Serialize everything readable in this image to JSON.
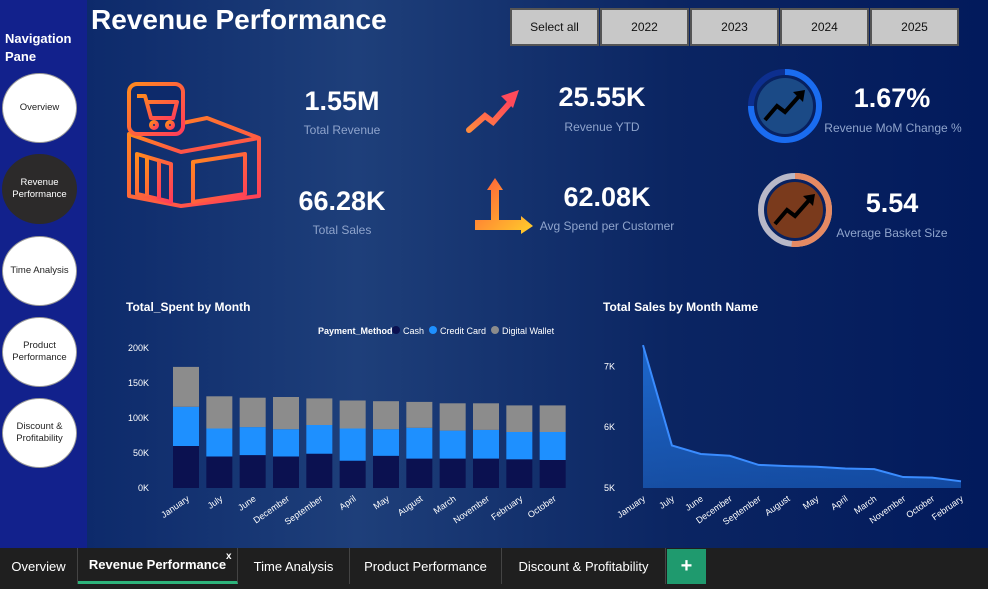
{
  "nav": {
    "title": "Navigation Pane",
    "buttons": [
      {
        "label": "Overview",
        "active": false
      },
      {
        "label": "Revenue Performance",
        "active": true
      },
      {
        "label": "Time Analysis",
        "active": false
      },
      {
        "label": "Product Performance",
        "active": false
      },
      {
        "label": "Discount & Profitability",
        "active": false
      }
    ]
  },
  "header": {
    "title": "Revenue Performance",
    "filters": [
      "Select all",
      "2022",
      "2023",
      "2024",
      "2025"
    ]
  },
  "kpis": {
    "total_revenue": {
      "value": "1.55M",
      "label": "Total Revenue"
    },
    "total_sales": {
      "value": "66.28K",
      "label": "Total Sales"
    },
    "revenue_ytd": {
      "value": "25.55K",
      "label": "Revenue YTD"
    },
    "avg_spend": {
      "value": "62.08K",
      "label": "Avg Spend per Customer"
    },
    "mom_change": {
      "value": "1.67%",
      "label": "Revenue MoM Change %"
    },
    "basket_size": {
      "value": "5.54",
      "label": "Average Basket Size"
    }
  },
  "colors": {
    "cash": "#0b1150",
    "credit_card": "#1e90ff",
    "digital_wallet": "#8c8c8c",
    "area": "#1f6fd8",
    "accent_tab": "#2db37b",
    "mom_ring": "#1a6cf0",
    "basket_ring": "#e58a63"
  },
  "chart_data": [
    {
      "type": "bar",
      "title": "Total_Spent by Month",
      "legend_title": "Payment_Method",
      "categories": [
        "January",
        "July",
        "June",
        "December",
        "September",
        "April",
        "May",
        "August",
        "March",
        "November",
        "February",
        "October"
      ],
      "y_ticks": [
        "0K",
        "50K",
        "100K",
        "150K",
        "200K"
      ],
      "ylim": [
        0,
        200000
      ],
      "series": [
        {
          "name": "Cash",
          "values": [
            60000,
            45000,
            47000,
            45000,
            49000,
            39000,
            46000,
            42000,
            42000,
            42000,
            41000,
            40000
          ]
        },
        {
          "name": "Credit Card",
          "values": [
            56000,
            40000,
            40000,
            39000,
            41000,
            46000,
            38000,
            44000,
            40000,
            41000,
            39000,
            40000
          ]
        },
        {
          "name": "Digital Wallet",
          "values": [
            57000,
            46000,
            42000,
            46000,
            38000,
            40000,
            40000,
            37000,
            39000,
            38000,
            38000,
            38000
          ]
        }
      ],
      "stacked": true,
      "legend": "top-right"
    },
    {
      "type": "area",
      "title": "Total Sales by Month Name",
      "categories": [
        "January",
        "July",
        "June",
        "December",
        "September",
        "August",
        "May",
        "April",
        "March",
        "November",
        "October",
        "February"
      ],
      "y_ticks": [
        "5K",
        "6K",
        "7K"
      ],
      "ylim": [
        5000,
        7500
      ],
      "values": [
        7350,
        5700,
        5560,
        5530,
        5380,
        5360,
        5350,
        5320,
        5310,
        5180,
        5170,
        5110
      ]
    }
  ],
  "tabs": [
    {
      "label": "Overview",
      "active": false
    },
    {
      "label": "Revenue Performance",
      "active": true
    },
    {
      "label": "Time Analysis",
      "active": false
    },
    {
      "label": "Product Performance",
      "active": false
    },
    {
      "label": "Discount & Profitability",
      "active": false
    }
  ],
  "tab_close": "x",
  "add_tab": "+"
}
